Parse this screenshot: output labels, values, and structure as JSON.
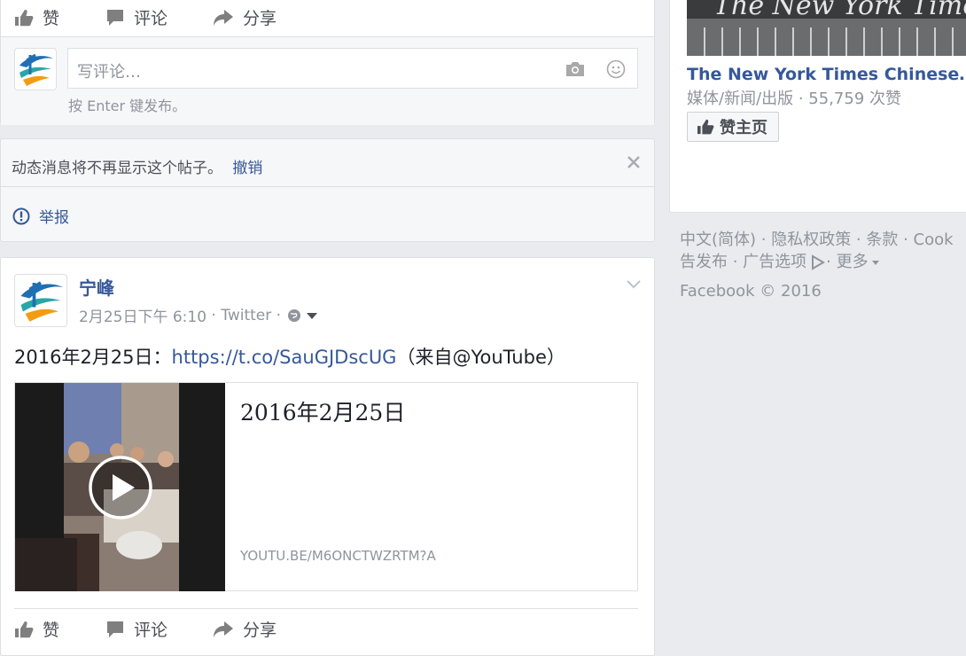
{
  "top_post": {
    "actions": {
      "like": "赞",
      "comment": "评论",
      "share": "分享"
    },
    "comment_box": {
      "placeholder": "写评论…",
      "hint": "按 Enter 键发布。",
      "camera_icon": "camera-icon",
      "emoji_icon": "emoji-icon"
    }
  },
  "hidden_notice": {
    "text": "动态消息将不再显示这个帖子。",
    "undo": "撤销",
    "report": "举报"
  },
  "post": {
    "author": "宁峰",
    "timestamp": "2月25日下午 6:10",
    "source": "Twitter",
    "sep1": " · ",
    "sep2": " · ",
    "text_prefix": "2016年2月25日：",
    "link": "https://t.co/SauGJDscUG",
    "text_suffix": "（来自@YouTube）",
    "attachment": {
      "title": "2016年2月25日",
      "domain": "YOUTU.BE/M6ONCTWZRTM?A"
    },
    "actions": {
      "like": "赞",
      "comment": "评论",
      "share": "分享"
    }
  },
  "sidebar": {
    "page_name": "The New York Times Chinese…",
    "category": "媒体/新闻/出版 · 55,759 次赞",
    "like_page_button": "赞主页",
    "footer_line1": "中文(简体) · 隐私权政策 · 条款 · Cook",
    "footer_line2_a": "告发布 · 广告选项",
    "footer_line2_b": "· 更多",
    "copyright": "Facebook © 2016"
  },
  "colors": {
    "link": "#365899",
    "background": "#e9ebee",
    "verified": "#4080ff"
  }
}
